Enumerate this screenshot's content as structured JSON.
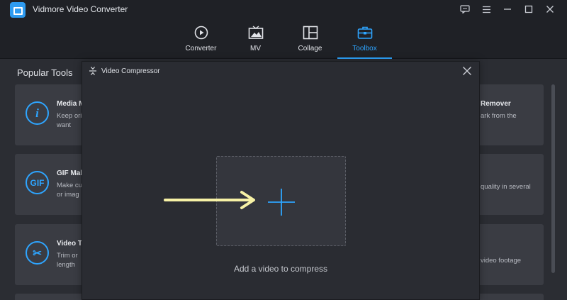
{
  "app": {
    "title": "Vidmore Video Converter",
    "accent": "#2ea5ff"
  },
  "window_controls": [
    "feedback-icon",
    "menu-icon",
    "minimize-icon",
    "maximize-icon",
    "close-icon"
  ],
  "nav": {
    "items": [
      {
        "label": "Converter",
        "icon": "converter-icon",
        "active": false
      },
      {
        "label": "MV",
        "icon": "mv-icon",
        "active": false
      },
      {
        "label": "Collage",
        "icon": "collage-icon",
        "active": false
      },
      {
        "label": "Toolbox",
        "icon": "toolbox-icon",
        "active": true
      }
    ]
  },
  "toolbox": {
    "section_title": "Popular Tools",
    "left_cards": [
      {
        "icon_text": "i",
        "title": "Media M",
        "desc": "Keep ori\nwant"
      },
      {
        "icon_text": "GIF",
        "title": "GIF Mak",
        "desc": "Make cu\nor imag"
      },
      {
        "icon_text": "✂",
        "title": "Video T",
        "desc": "Trim or\nlength"
      }
    ],
    "right_cards": [
      {
        "title": "Remover",
        "desc": "ark from the"
      },
      {
        "title": "",
        "desc": "quality in several"
      },
      {
        "title": "",
        "desc": "video footage"
      }
    ]
  },
  "modal": {
    "title": "Video Compressor",
    "hint": "Add a video to compress",
    "arrow_color": "#f7f2a6"
  }
}
